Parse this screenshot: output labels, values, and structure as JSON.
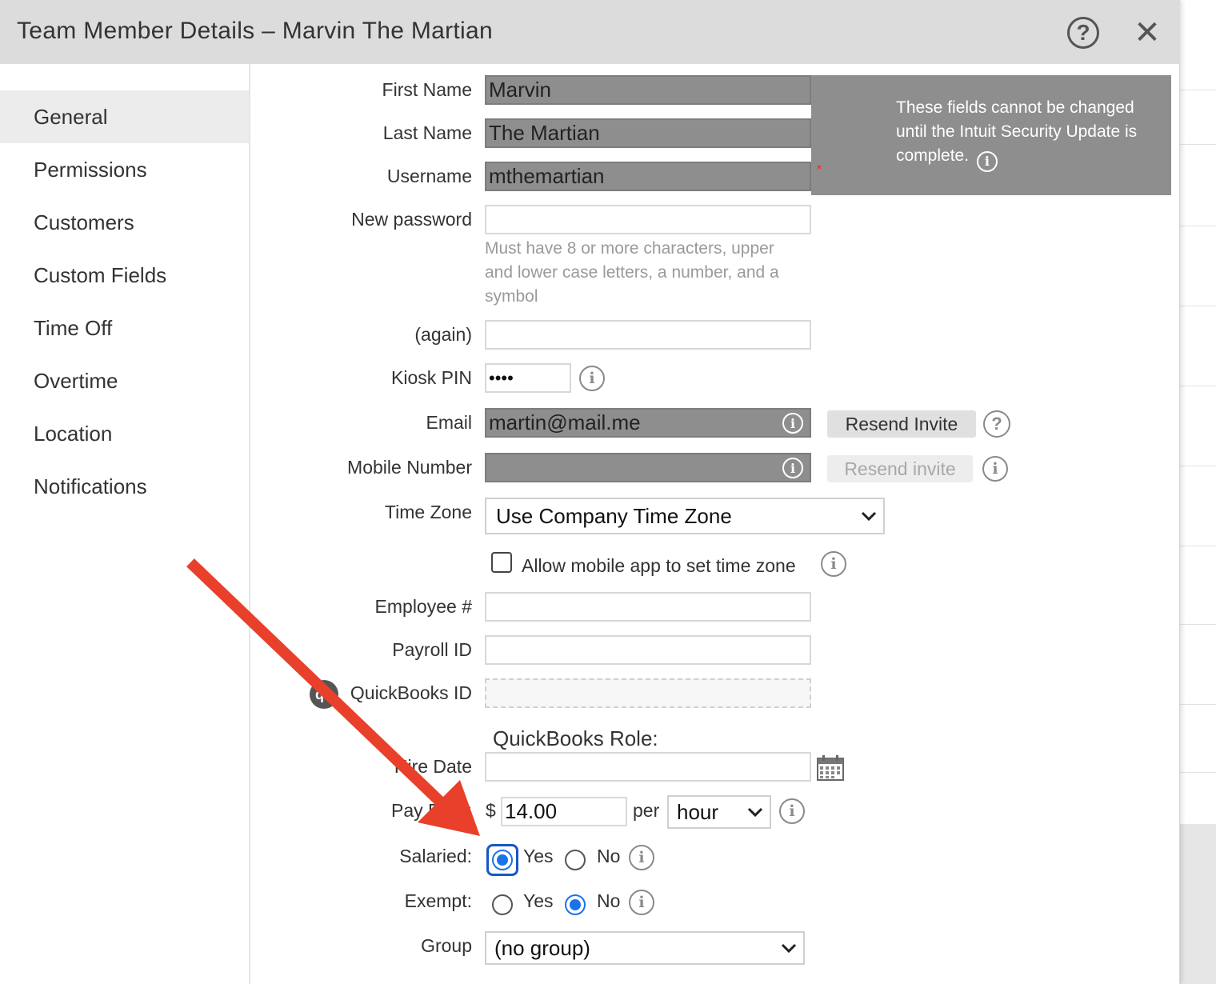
{
  "dialog": {
    "title": "Team Member Details – Marvin The Martian",
    "help_icon": "question-circle-icon",
    "close_icon": "close-icon",
    "close_glyph": "✕"
  },
  "sidebar": {
    "items": [
      {
        "label": "General",
        "active": true
      },
      {
        "label": "Permissions"
      },
      {
        "label": "Customers"
      },
      {
        "label": "Custom Fields"
      },
      {
        "label": "Time Off"
      },
      {
        "label": "Overtime"
      },
      {
        "label": "Location"
      },
      {
        "label": "Notifications"
      }
    ]
  },
  "form": {
    "first_name": {
      "label": "First Name",
      "value": "Marvin"
    },
    "last_name": {
      "label": "Last Name",
      "value": "The Martian"
    },
    "username": {
      "label": "Username",
      "value": "mthemartian",
      "required_mark": "*"
    },
    "locked_note": "These fields cannot be changed until the Intuit Security Update is complete.",
    "new_password": {
      "label": "New password",
      "value": ""
    },
    "password_hint": "Must have 8 or more characters, upper and lower case letters, a number, and a symbol",
    "password_again": {
      "label": "(again)",
      "value": ""
    },
    "kiosk_pin": {
      "label": "Kiosk PIN",
      "value": "••••"
    },
    "email": {
      "label": "Email",
      "value": "martin@mail.me",
      "button": "Resend Invite"
    },
    "mobile": {
      "label": "Mobile Number",
      "value": "",
      "button": "Resend invite"
    },
    "time_zone": {
      "label": "Time Zone",
      "selected": "Use Company Time Zone"
    },
    "allow_mobile_tz": {
      "label": "Allow mobile app to set time zone",
      "checked": false
    },
    "employee_no": {
      "label": "Employee #",
      "value": ""
    },
    "payroll_id": {
      "label": "Payroll ID",
      "value": ""
    },
    "quickbooks_id": {
      "label": "QuickBooks ID",
      "value": "",
      "logo_text": "qb"
    },
    "quickbooks_role": "QuickBooks Role:",
    "hire_date": {
      "label": "Hire Date",
      "value": ""
    },
    "pay_rate": {
      "label": "Pay Rate:",
      "currency": "$",
      "value": "14.00",
      "per": "per",
      "unit": "hour"
    },
    "salaried": {
      "label": "Salaried:",
      "yes": "Yes",
      "no": "No",
      "selected": "yes"
    },
    "exempt": {
      "label": "Exempt:",
      "yes": "Yes",
      "no": "No",
      "selected": "no"
    },
    "group": {
      "label": "Group",
      "selected": "(no group)"
    }
  },
  "colors": {
    "annotation_arrow": "#e8402a",
    "radio_selected": "#1a73e8",
    "locked_bg": "#8e8e8e"
  }
}
